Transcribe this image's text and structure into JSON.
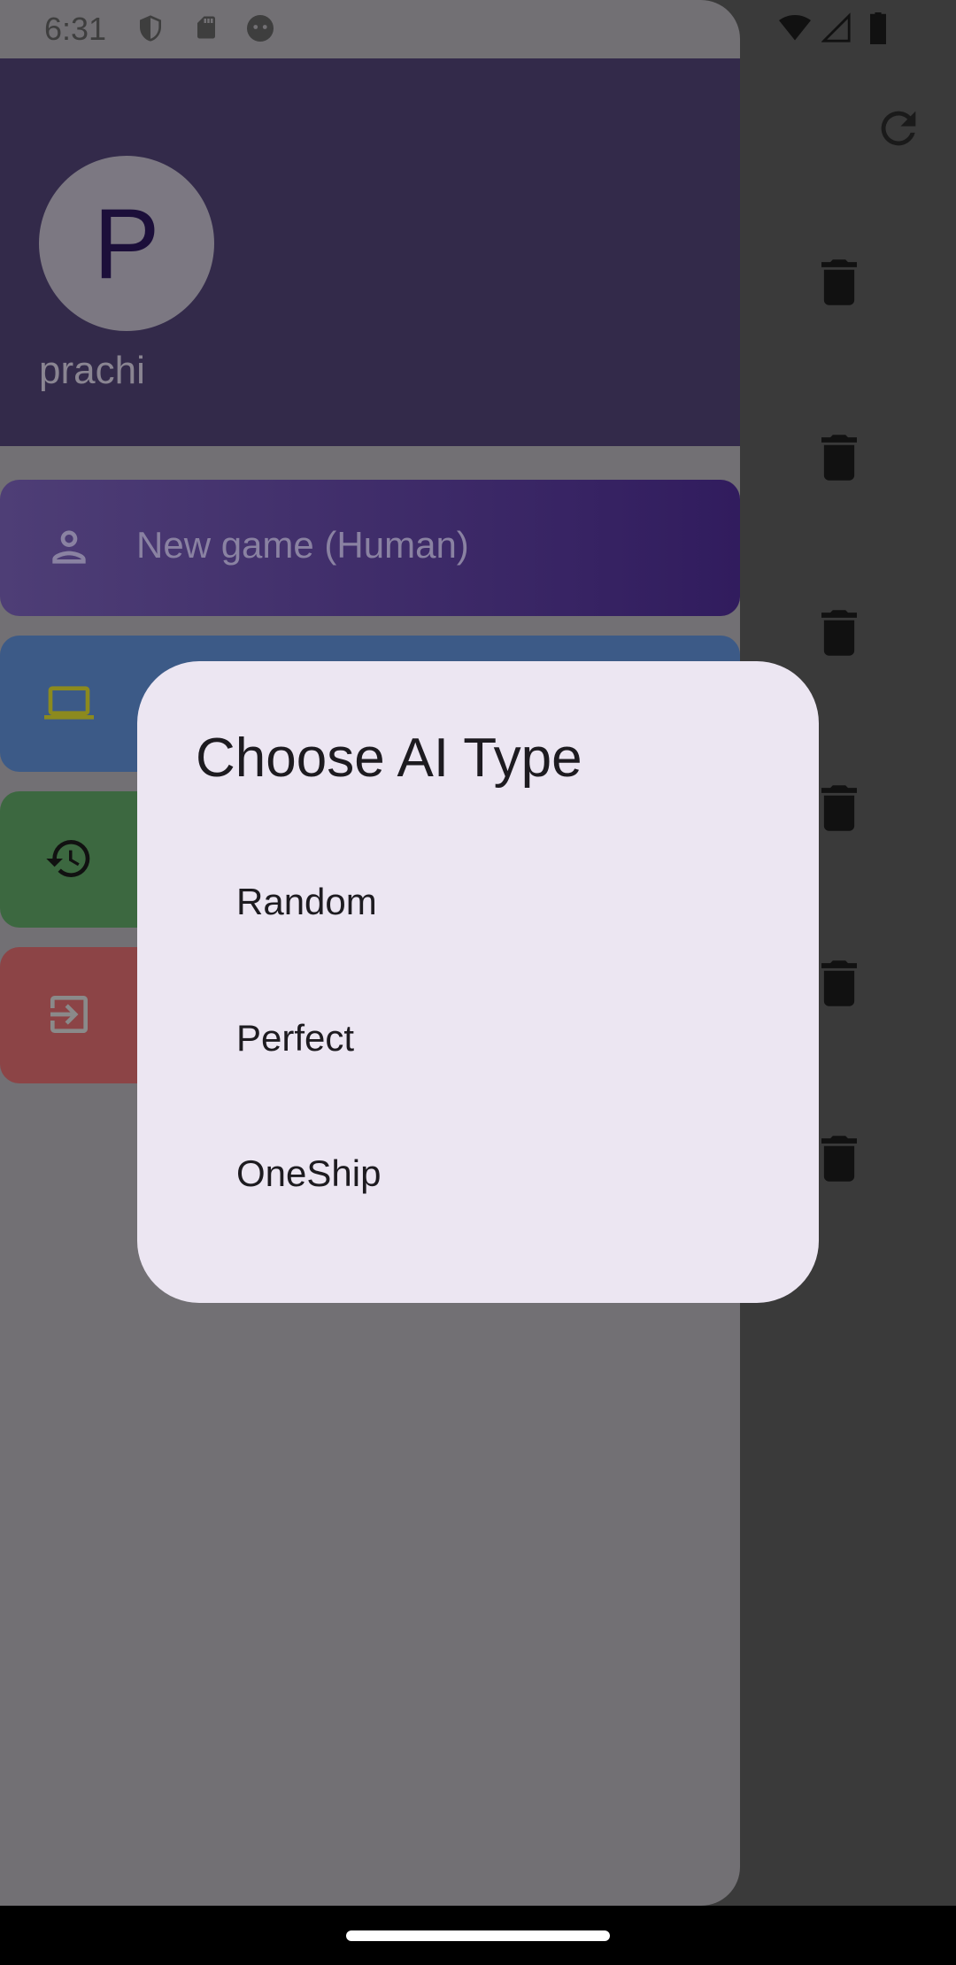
{
  "status_bar": {
    "time": "6:31",
    "left_icons": [
      "shield-icon",
      "sd-card-icon",
      "face-icon"
    ],
    "right_icons": [
      "wifi-icon",
      "signal-icon",
      "battery-icon"
    ]
  },
  "background": {
    "icons": [
      "refresh-icon",
      "trash-icon",
      "trash-icon",
      "trash-icon",
      "trash-icon",
      "trash-icon",
      "trash-icon"
    ]
  },
  "drawer": {
    "avatar_letter": "P",
    "username": "prachi",
    "menu": [
      {
        "label": "New game (Human)",
        "icon": "person-icon",
        "color": "#4e3e76"
      },
      {
        "label": "",
        "icon": "laptop-icon",
        "color": "#3c5a87"
      },
      {
        "label": "",
        "icon": "history-icon",
        "color": "#3c6840"
      },
      {
        "label": "",
        "icon": "logout-icon",
        "color": "#8c4446"
      }
    ]
  },
  "dialog": {
    "title": "Choose AI Type",
    "options": [
      "Random",
      "Perfect",
      "OneShip"
    ]
  },
  "colors": {
    "dialog_bg": "#ece6f2",
    "header_bg": "#332a4a",
    "scrim": "#727074"
  }
}
